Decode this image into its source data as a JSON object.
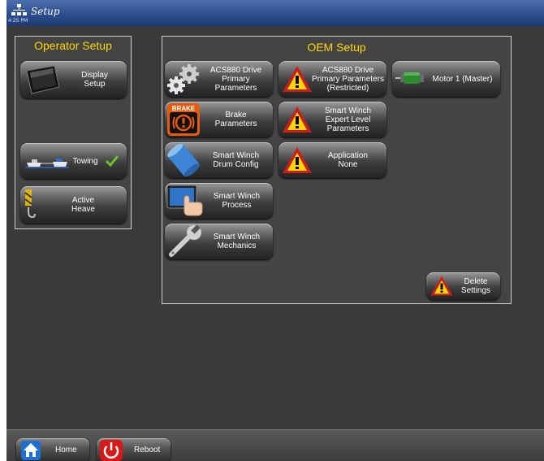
{
  "window": {
    "title": "Setup",
    "time": "4:25 PM"
  },
  "operator": {
    "title": "Operator Setup",
    "display_setup": [
      "Display",
      "Setup"
    ],
    "towing": "Towing",
    "active_heave": [
      "Active",
      "Heave"
    ]
  },
  "oem": {
    "title": "OEM Setup",
    "acs880_primary": [
      "ACS880 Drive",
      "Primary Parameters"
    ],
    "acs880_restricted": [
      "ACS880 Drive",
      "Primary Parameters",
      "(Restricted)"
    ],
    "motor_master": "Motor 1 (Master)",
    "brake_badge": "BRAKE",
    "brake_params": [
      "Brake",
      "Parameters"
    ],
    "smart_winch_expert": [
      "Smart Winch",
      "Expert Level",
      "Parameters"
    ],
    "drum_config": [
      "Smart Winch",
      "Drum Config"
    ],
    "application": [
      "Application",
      "None"
    ],
    "process": [
      "Smart Winch",
      "Process"
    ],
    "mechanics": [
      "Smart Winch",
      "Mechanics"
    ],
    "delete_settings": [
      "Delete",
      "Settings"
    ]
  },
  "footer": {
    "home": "Home",
    "reboot": "Reboot"
  },
  "colors": {
    "title_yellow": "#ffd700",
    "titlebar_blue": "#2c4e8f",
    "warning_red": "#c81e1e",
    "check_green": "#6cc22a"
  }
}
